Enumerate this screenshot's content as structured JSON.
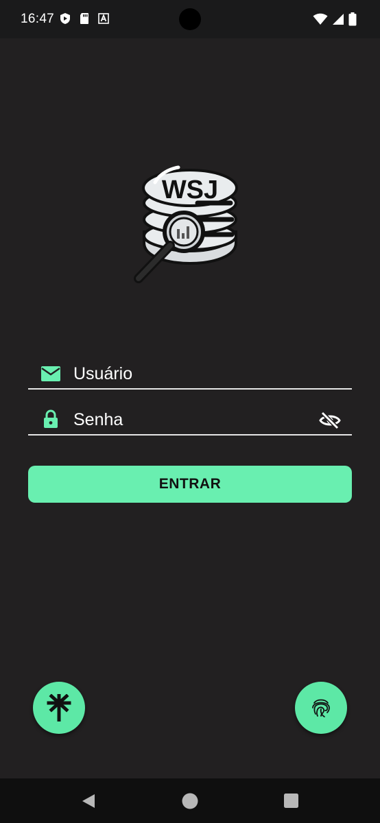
{
  "status_bar": {
    "time": "16:47",
    "left_icons": [
      "shield-play-icon",
      "sd-card-icon",
      "font-a-icon"
    ],
    "right_icons": [
      "wifi-icon",
      "signal-icon",
      "battery-icon"
    ]
  },
  "logo": {
    "text": "WSJ",
    "icon": "database-magnifier-logo"
  },
  "form": {
    "username": {
      "placeholder": "Usuário",
      "value": "",
      "icon": "email-icon"
    },
    "password": {
      "placeholder": "Senha",
      "value": "",
      "icon": "lock-icon",
      "toggle_icon": "eye-off-icon"
    },
    "submit_label": "ENTRAR"
  },
  "fabs": {
    "left_icon": "linktree-icon",
    "right_icon": "fingerprint-icon"
  },
  "nav_bar": {
    "icons": [
      "back-icon",
      "home-icon",
      "recents-icon"
    ]
  },
  "colors": {
    "background": "#222021",
    "accent": "#69efb0",
    "underline": "#e6e6e6",
    "text": "#ffffff"
  }
}
